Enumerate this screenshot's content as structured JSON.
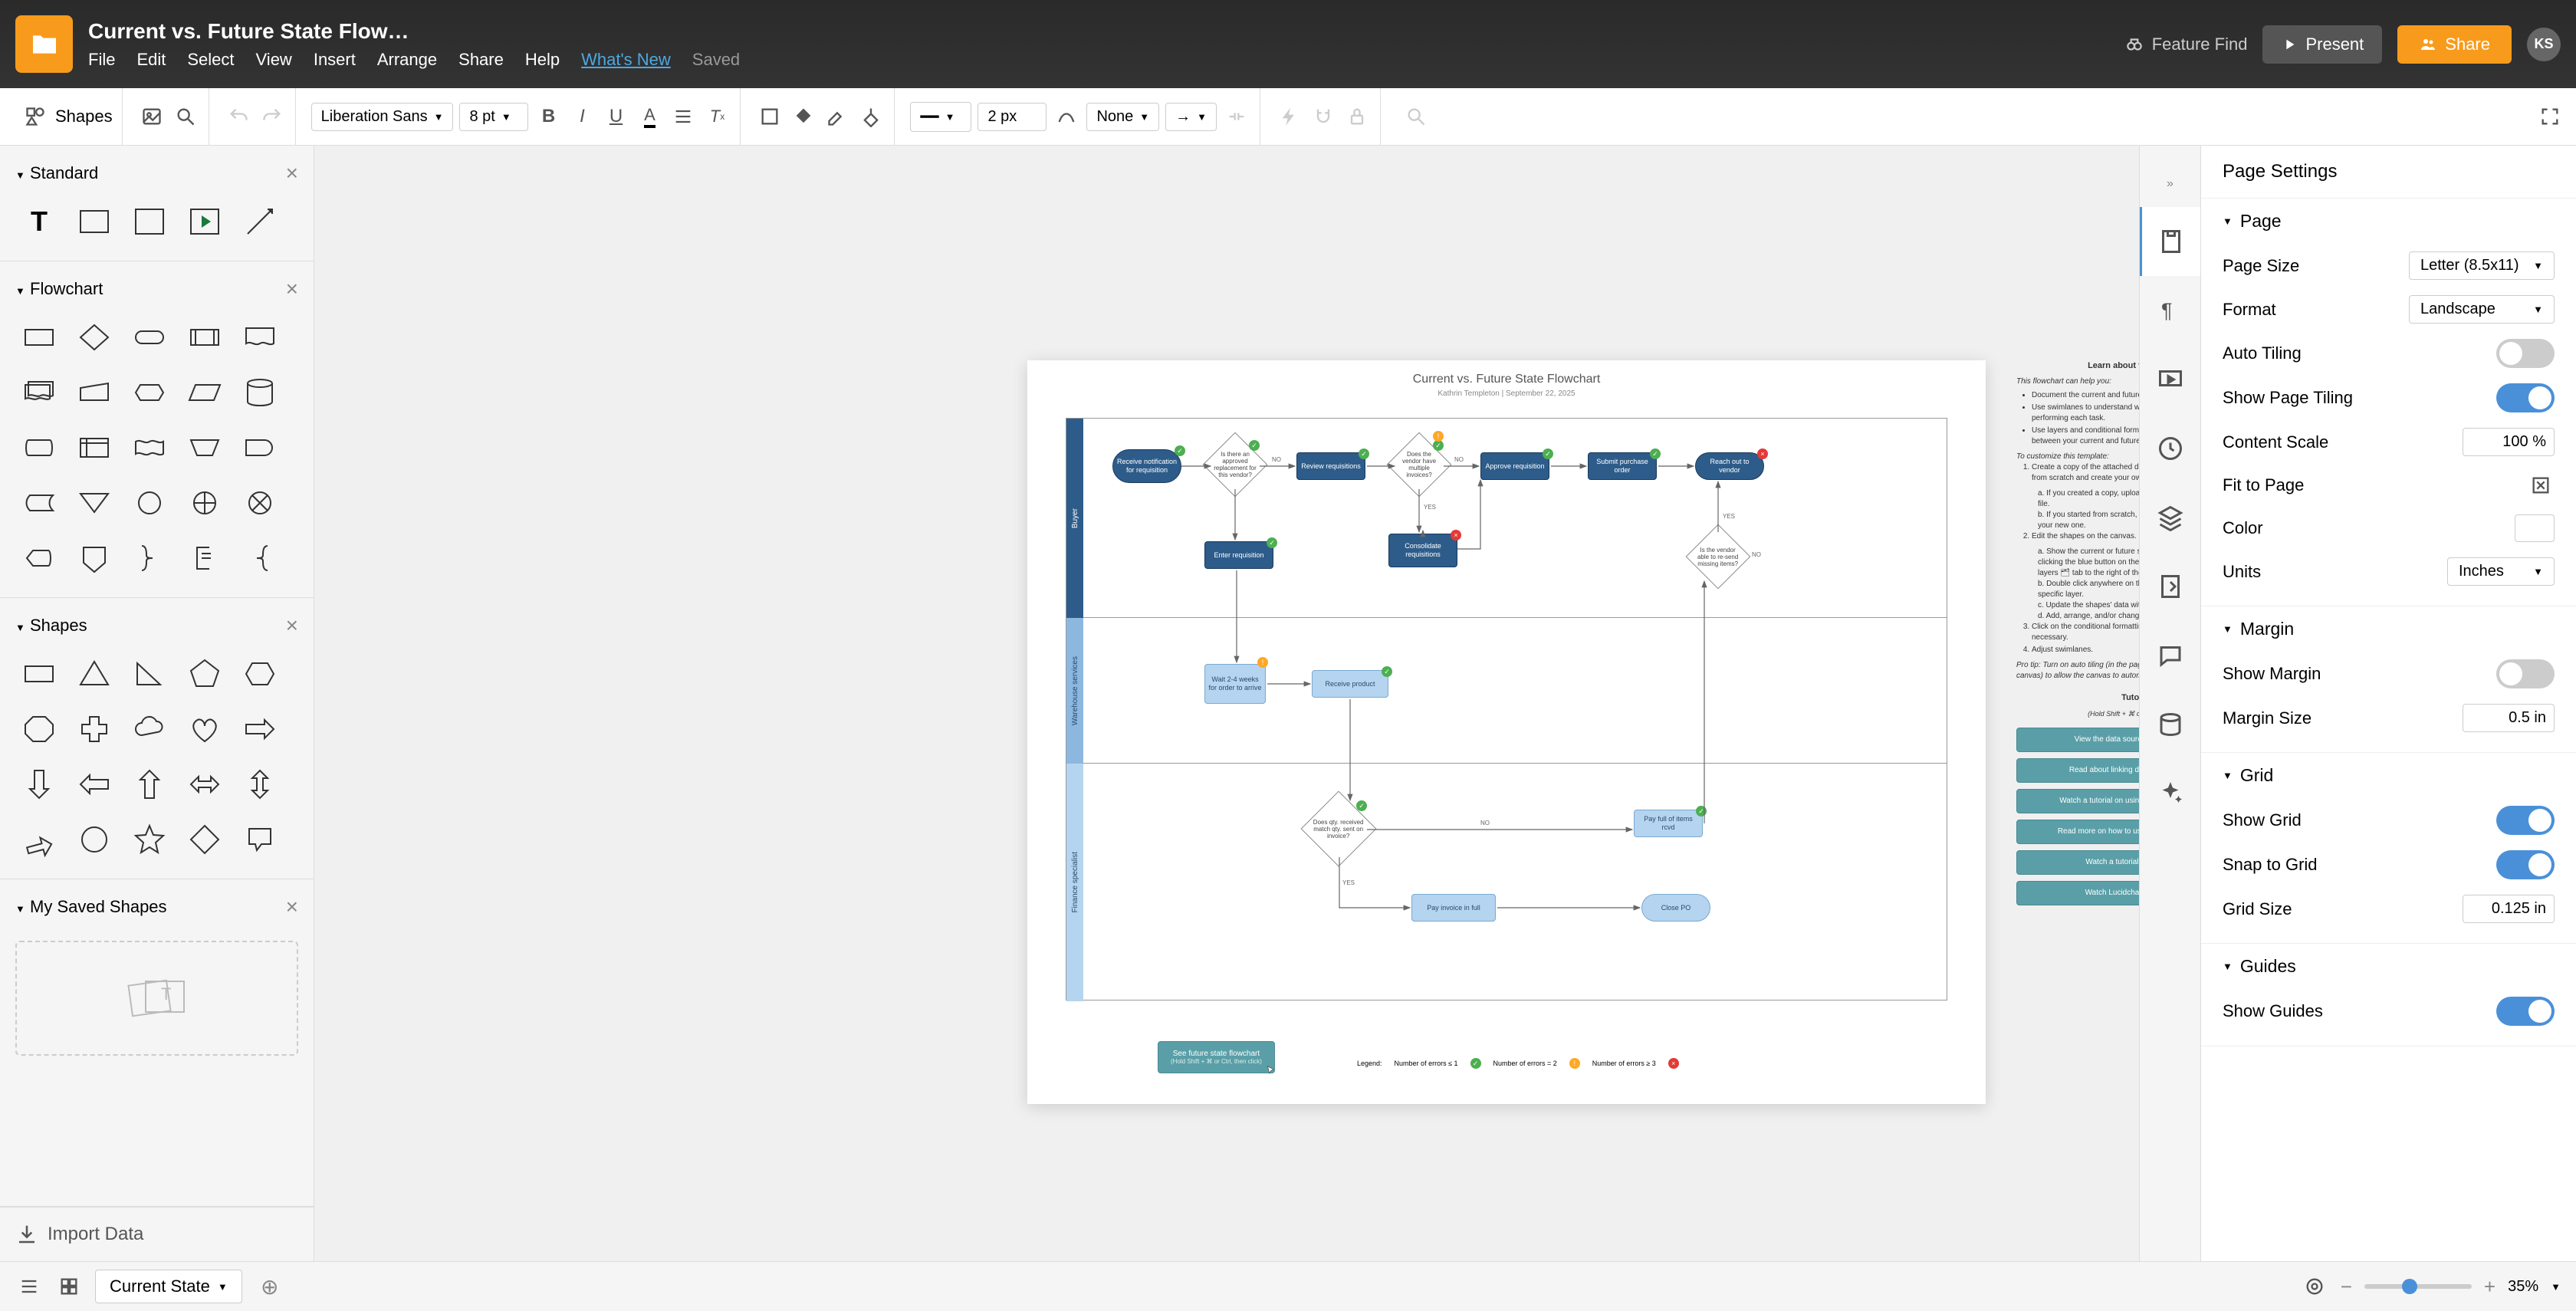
{
  "doc_title": "Current vs. Future State Flow…",
  "menus": [
    "File",
    "Edit",
    "Select",
    "View",
    "Insert",
    "Arrange",
    "Share",
    "Help"
  ],
  "whats_new": "What's New",
  "saved": "Saved",
  "feature_find": "Feature Find",
  "present": "Present",
  "share": "Share",
  "avatar": "KS",
  "toolbar": {
    "shapes": "Shapes",
    "font": "Liberation Sans",
    "font_size": "8 pt",
    "stroke_width": "2 px",
    "arrow_style": "None"
  },
  "left": {
    "sections": {
      "standard": "Standard",
      "flowchart": "Flowchart",
      "shapes": "Shapes",
      "saved": "My Saved Shapes"
    },
    "import": "Import Data"
  },
  "flowchart": {
    "title": "Current vs. Future State Flowchart",
    "subtitle": "Kathrin Templeton | September 22, 2025",
    "lanes": [
      "Buyer",
      "Warehouse services",
      "Finance specialist"
    ],
    "nodes": {
      "receive_notification": "Receive notification for requisition",
      "q_replacement": "Is there an approved replacement for this vendor?",
      "review_requisitions": "Review requisitions",
      "q_multiple": "Does the vendor have multiple invoices?",
      "approve_requisition": "Approve requisition",
      "submit_po": "Submit purchase order",
      "reach_vendor": "Reach out to vendor",
      "enter_requisition": "Enter requisition",
      "consolidate": "Consolidate requisitions",
      "q_resend": "Is the vendor able to re-send missing items?",
      "wait_weeks": "Wait 2-4 weeks for order to arrive",
      "receive_product": "Receive product",
      "q_match": "Does qty. received match qty. sent on invoice?",
      "pay_all_short": "Pay full of items rcvd",
      "pay_full": "Pay invoice in full",
      "close_po": "Close PO"
    },
    "yes": "YES",
    "no": "NO",
    "legend_label": "Legend:",
    "legend": [
      {
        "label": "Number of errors ≤ 1",
        "color": "g"
      },
      {
        "label": "Number of errors = 2",
        "color": "y"
      },
      {
        "label": "Number of errors ≥ 3",
        "color": "r"
      }
    ],
    "future_btn": "See future state flowchart",
    "future_hint": "(Hold Shift + ⌘ or Ctrl, then click)"
  },
  "template_guide": {
    "title": "Learn about this template",
    "intro": "This flowchart can help you:",
    "bullets": [
      "Document the current and future state of a defined process.",
      "Use swimlanes to understand which department is responsible for performing each task.",
      "Use layers and conditional formatting to quickly identify changes between your current and future process using."
    ],
    "customize_label": "To customize this template:",
    "steps": [
      "Create a copy of the attached data file to use as a template, or start from scratch and create your own data file.",
      "a. If you created a copy, upload your copy and replace the current file.",
      "b. If you started from scratch, delete the current file and upload your new one.",
      "Edit the shapes on the canvas.",
      "a. Show the current or future state you want to edit by either clicking the blue button on the bottom of the canvas or clicking the layers 🗂 tab to the right of the editor.",
      "b. Double click anywhere on the canvas to edit the shapes on a specific layer.",
      "c. Update the shapes' data within this diagram.",
      "d. Add, arrange, and/or change shapes as needed.",
      "Click on the conditional formatting icon 🔧 to update rules as necessary.",
      "Adjust swimlanes."
    ],
    "pro_tip": "Pro tip: Turn on auto tiling (in the page settings 📄 tab to the right of the canvas) to allow the canvas to automatically adjust.",
    "tutorials_label": "Tutorials",
    "tutorials_hint": "(Hold Shift + ⌘ or Ctrl, then click)",
    "tutorial_btns": [
      "View the data source for this flowchart",
      "Read about linking data to your diagrams",
      "Watch a tutorial on using conditional formatting",
      "Read more on how to use conditional formatting",
      "Watch a tutorial on using layers",
      "Watch Lucidchart basic tutorials"
    ]
  },
  "right": {
    "title": "Page Settings",
    "page": {
      "header": "Page",
      "size_label": "Page Size",
      "size_value": "Letter (8.5x11)",
      "format_label": "Format",
      "format_value": "Landscape",
      "auto_tiling": "Auto Tiling",
      "show_tiling": "Show Page Tiling",
      "content_scale": "Content Scale",
      "content_scale_value": "100 %",
      "fit": "Fit to Page",
      "color": "Color",
      "units": "Units",
      "units_value": "Inches"
    },
    "margin": {
      "header": "Margin",
      "show": "Show Margin",
      "size_label": "Margin Size",
      "size_value": "0.5 in"
    },
    "grid": {
      "header": "Grid",
      "show": "Show Grid",
      "snap": "Snap to Grid",
      "size_label": "Grid Size",
      "size_value": "0.125 in"
    },
    "guides": {
      "header": "Guides",
      "show": "Show Guides"
    }
  },
  "bottom": {
    "page_tab": "Current State",
    "zoom": "35%"
  },
  "chart_data": {
    "type": "flowchart",
    "swimlanes": [
      "Buyer",
      "Warehouse services",
      "Finance specialist"
    ],
    "nodes": [
      {
        "id": "n1",
        "lane": 0,
        "type": "process",
        "label": "Receive notification for requisition",
        "style": "dark",
        "badge": "g"
      },
      {
        "id": "n2",
        "lane": 0,
        "type": "decision",
        "label": "Is there an approved replacement for this vendor?",
        "badge": "g"
      },
      {
        "id": "n3",
        "lane": 0,
        "type": "process",
        "label": "Review requisitions",
        "style": "dark",
        "badge": "g"
      },
      {
        "id": "n4",
        "lane": 0,
        "type": "decision",
        "label": "Does the vendor have multiple invoices?",
        "badge": "g"
      },
      {
        "id": "n5",
        "lane": 0,
        "type": "process",
        "label": "Approve requisition",
        "style": "dark",
        "badge": "g"
      },
      {
        "id": "n6",
        "lane": 0,
        "type": "process",
        "label": "Submit purchase order",
        "style": "dark",
        "badge": "g"
      },
      {
        "id": "n7",
        "lane": 0,
        "type": "process",
        "label": "Reach out to vendor",
        "style": "dark",
        "badge": "r"
      },
      {
        "id": "n8",
        "lane": 0,
        "type": "process",
        "label": "Enter requisition",
        "style": "dark",
        "badge": "g"
      },
      {
        "id": "n9",
        "lane": 0,
        "type": "process",
        "label": "Consolidate requisitions",
        "style": "dark",
        "badge": "r"
      },
      {
        "id": "n10",
        "lane": 0,
        "type": "decision",
        "label": "Is the vendor able to re-send missing items?"
      },
      {
        "id": "n11",
        "lane": 1,
        "type": "process",
        "label": "Wait 2-4 weeks for order to arrive",
        "style": "light",
        "badge": "y"
      },
      {
        "id": "n12",
        "lane": 1,
        "type": "process",
        "label": "Receive product",
        "style": "light",
        "badge": "g"
      },
      {
        "id": "n13",
        "lane": 2,
        "type": "decision",
        "label": "Does qty. received match qty. sent on invoice?",
        "badge": "g"
      },
      {
        "id": "n14",
        "lane": 2,
        "type": "process",
        "label": "Pay full of items rcvd",
        "style": "light",
        "badge": "g"
      },
      {
        "id": "n15",
        "lane": 2,
        "type": "process",
        "label": "Pay invoice in full",
        "style": "light"
      },
      {
        "id": "n16",
        "lane": 2,
        "type": "process",
        "label": "Close PO",
        "style": "light"
      }
    ],
    "edges": [
      {
        "from": "n1",
        "to": "n2"
      },
      {
        "from": "n2",
        "to": "n3",
        "label": "NO"
      },
      {
        "from": "n3",
        "to": "n4"
      },
      {
        "from": "n4",
        "to": "n5",
        "label": "NO"
      },
      {
        "from": "n5",
        "to": "n6"
      },
      {
        "from": "n6",
        "to": "n7"
      },
      {
        "from": "n2",
        "to": "n8"
      },
      {
        "from": "n4",
        "to": "n9",
        "label": "YES"
      },
      {
        "from": "n9",
        "to": "n5"
      },
      {
        "from": "n8",
        "to": "n11"
      },
      {
        "from": "n11",
        "to": "n12"
      },
      {
        "from": "n12",
        "to": "n13"
      },
      {
        "from": "n13",
        "to": "n14",
        "label": "NO"
      },
      {
        "from": "n13",
        "to": "n15",
        "label": "YES"
      },
      {
        "from": "n14",
        "to": "n7"
      },
      {
        "from": "n15",
        "to": "n16"
      },
      {
        "from": "n10",
        "to": "n7",
        "label": "YES"
      }
    ]
  }
}
